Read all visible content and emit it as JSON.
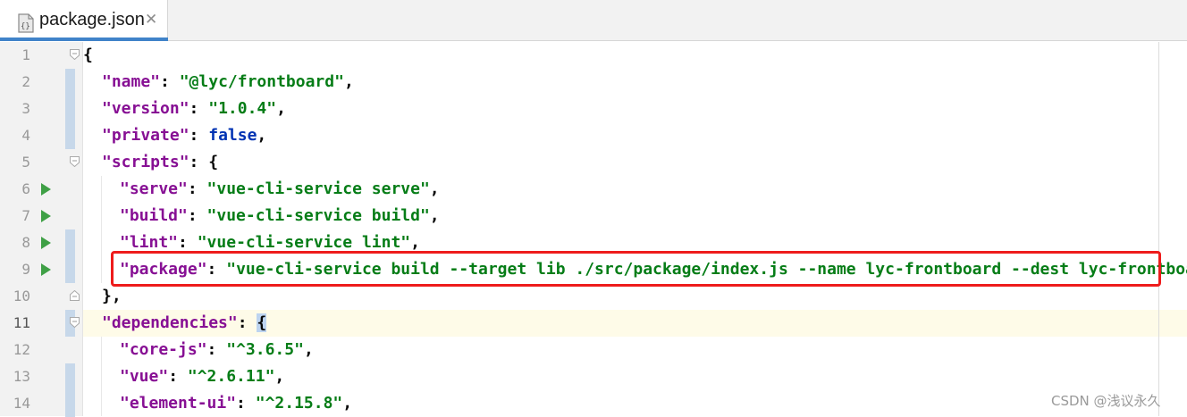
{
  "tab": {
    "title": "package.json",
    "icon": "json-file-icon",
    "close_glyph": "✕"
  },
  "editor": {
    "current_line": 11,
    "lines": [
      {
        "n": "1",
        "text": "{"
      },
      {
        "n": "2",
        "key": "\"name\"",
        "sep": ": ",
        "value": "\"@lyc/frontboard\"",
        "tail": ","
      },
      {
        "n": "3",
        "key": "\"version\"",
        "sep": ": ",
        "value": "\"1.0.4\"",
        "tail": ","
      },
      {
        "n": "4",
        "key": "\"private\"",
        "sep": ": ",
        "value": "false",
        "tail": ","
      },
      {
        "n": "5",
        "key": "\"scripts\"",
        "sep": ": ",
        "tail": "{"
      },
      {
        "n": "6",
        "key": "\"serve\"",
        "sep": ": ",
        "value": "\"vue-cli-service serve\"",
        "tail": ","
      },
      {
        "n": "7",
        "key": "\"build\"",
        "sep": ": ",
        "value": "\"vue-cli-service build\"",
        "tail": ","
      },
      {
        "n": "8",
        "key": "\"lint\"",
        "sep": ": ",
        "value": "\"vue-cli-service lint\"",
        "tail": ","
      },
      {
        "n": "9",
        "key": "\"package\"",
        "sep": ": ",
        "value": "\"vue-cli-service build --target lib ./src/package/index.js --name lyc-frontboard --dest lyc-frontboard\""
      },
      {
        "n": "10",
        "text": "},"
      },
      {
        "n": "11",
        "key": "\"dependencies\"",
        "sep": ": ",
        "tail": "{"
      },
      {
        "n": "12",
        "key": "\"core-js\"",
        "sep": ": ",
        "value": "\"^3.6.5\"",
        "tail": ","
      },
      {
        "n": "13",
        "key": "\"vue\"",
        "sep": ": ",
        "value": "\"^2.6.11\"",
        "tail": ","
      },
      {
        "n": "14",
        "key": "\"element-ui\"",
        "sep": ": ",
        "value": "\"^2.15.8\"",
        "tail": ","
      }
    ]
  },
  "watermark": "CSDN @浅议永久",
  "colors": {
    "key": "#871094",
    "string": "#067d17",
    "keyword": "#0033b3",
    "highlight_border": "#ee1c1c",
    "run_icon": "#3fa046"
  }
}
